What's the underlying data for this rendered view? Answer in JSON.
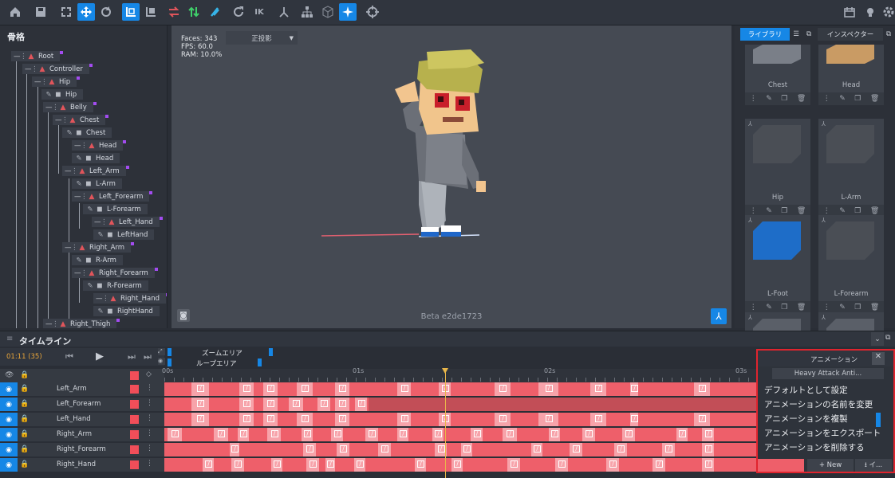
{
  "toolbar": {
    "icons": [
      "home-icon",
      "save-icon",
      "fullscreen-icon",
      "move-icon",
      "rotate-icon",
      "local-axis-icon",
      "pivot-icon",
      "swap-icon",
      "bones-icon",
      "ik-chain-icon",
      "refresh-icon",
      "ik-label",
      "bone-icon",
      "hierarchy-icon",
      "cube-icon",
      "sparkle-icon",
      "target-icon",
      "calendar-icon",
      "bulb-icon",
      "settings-icon"
    ],
    "ik_label": "IK"
  },
  "bones_panel": {
    "title": "骨格",
    "nodes": [
      {
        "label": "Root",
        "kind": "bone"
      },
      {
        "label": "Controller",
        "kind": "bone"
      },
      {
        "label": "Hip",
        "kind": "bone"
      },
      {
        "label": "Hip",
        "kind": "mesh"
      },
      {
        "label": "Belly",
        "kind": "bone"
      },
      {
        "label": "Chest",
        "kind": "bone"
      },
      {
        "label": "Chest",
        "kind": "mesh"
      },
      {
        "label": "Head",
        "kind": "bone"
      },
      {
        "label": "Head",
        "kind": "mesh"
      },
      {
        "label": "Left_Arm",
        "kind": "bone"
      },
      {
        "label": "L-Arm",
        "kind": "mesh"
      },
      {
        "label": "Left_Forearm",
        "kind": "bone"
      },
      {
        "label": "L-Forearm",
        "kind": "mesh"
      },
      {
        "label": "Left_Hand",
        "kind": "bone"
      },
      {
        "label": "LeftHand",
        "kind": "mesh"
      },
      {
        "label": "Right_Arm",
        "kind": "bone"
      },
      {
        "label": "R-Arm",
        "kind": "mesh"
      },
      {
        "label": "Right_Forearm",
        "kind": "bone"
      },
      {
        "label": "R-Forearm",
        "kind": "mesh"
      },
      {
        "label": "Right_Hand",
        "kind": "bone"
      },
      {
        "label": "RightHand",
        "kind": "mesh"
      },
      {
        "label": "Right_Thigh",
        "kind": "bone"
      }
    ]
  },
  "viewport": {
    "faces": "Faces: 343",
    "fps": "FPS: 60.0",
    "ram": "RAM: 10.0%",
    "projection": "正投影",
    "build": "Beta e2de1723"
  },
  "library": {
    "tab_library": "ライブラリ",
    "tab_inspector": "インスペクター",
    "items": [
      "Chest",
      "Head",
      "Hip",
      "L-Arm",
      "L-Foot",
      "L-Forearm",
      "",
      ""
    ]
  },
  "timeline": {
    "title": "タイムライン",
    "time": "01:11 (35)",
    "zoom_area": "ズームエリア",
    "loop_area": "ループエリア",
    "ticks": [
      "00s",
      "01s",
      "02s",
      "03s"
    ],
    "rows": [
      "Left_Arm",
      "Left_Forearm",
      "Left_Hand",
      "Right_Arm",
      "Right_Forearm",
      "Right_Hand"
    ]
  },
  "animation_popup": {
    "title": "アニメーション",
    "current": "Heavy Attack Anti...",
    "menu": [
      "デフォルトとして設定",
      "アニメーションの名前を変更",
      "アニメーションを複製",
      "アニメーションをエクスポート",
      "アニメーションを削除する"
    ],
    "new_label": "+ New",
    "import_label": "⭳ イ..."
  },
  "colors": {
    "accent": "#1687e6",
    "keyframe": "#ee5f6a",
    "highlight": "#e0242e",
    "bone": "#e0555b"
  }
}
